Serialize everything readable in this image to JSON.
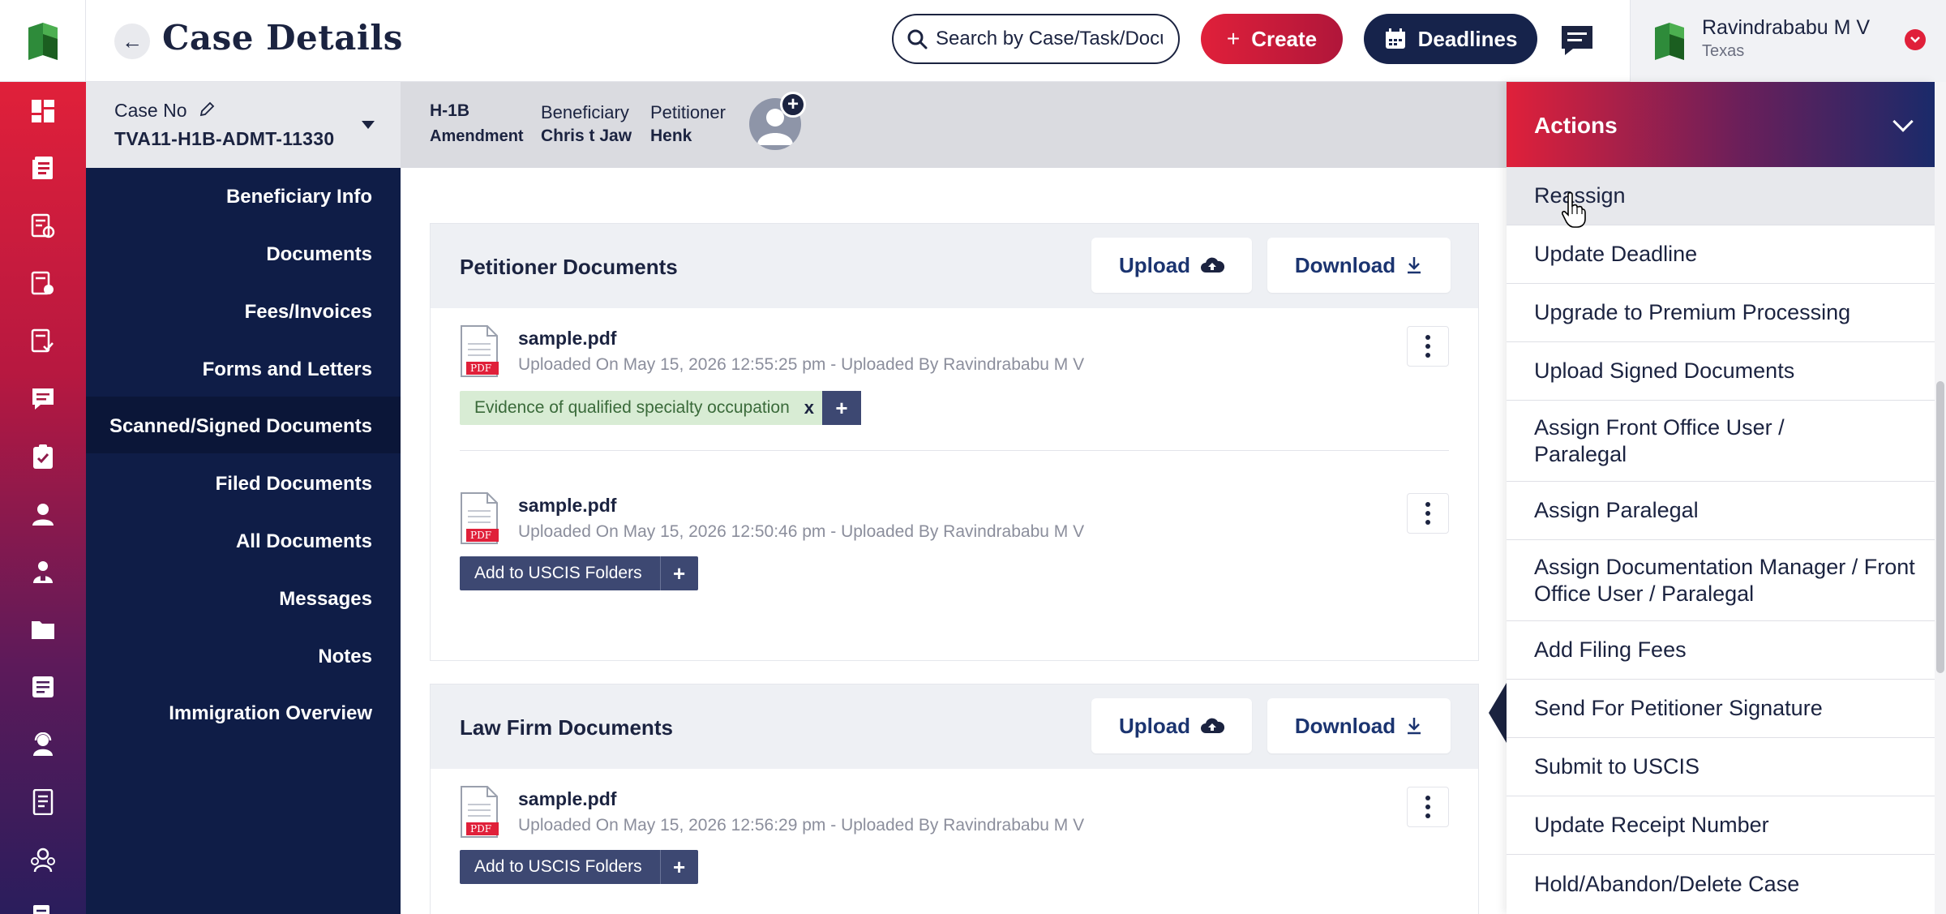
{
  "header": {
    "title": "Case Details",
    "search_placeholder": "Search by Case/Task/Document",
    "create_label": "Create",
    "deadlines_label": "Deadlines",
    "user": {
      "name": "Ravindrababu M V",
      "location": "Texas"
    }
  },
  "case": {
    "case_no_label": "Case No",
    "case_no": "TVA11-H1B-ADMT-11330",
    "visa_type": "H-1B",
    "case_kind": "Amendment",
    "beneficiary_label": "Beneficiary",
    "beneficiary": "Chris t Jaw",
    "petitioner_label": "Petitioner",
    "petitioner": "Henk"
  },
  "subnav": {
    "items": [
      {
        "label": "Beneficiary Info"
      },
      {
        "label": "Documents"
      },
      {
        "label": "Fees/Invoices"
      },
      {
        "label": "Forms and Letters"
      },
      {
        "label": "Scanned/Signed Documents"
      },
      {
        "label": "Filed Documents"
      },
      {
        "label": "All Documents"
      },
      {
        "label": "Messages"
      },
      {
        "label": "Notes"
      },
      {
        "label": "Immigration Overview"
      }
    ],
    "active": "Scanned/Signed Documents"
  },
  "sections": [
    {
      "title": "Petitioner Documents",
      "upload_label": "Upload",
      "download_label": "Download",
      "docs": [
        {
          "name": "sample.pdf",
          "meta": "Uploaded On May 15, 2026 12:55:25 pm - Uploaded By Ravindrababu M V",
          "tag": "Evidence of qualified specialty occupation",
          "tag_close": "x"
        },
        {
          "name": "sample.pdf",
          "meta": "Uploaded On May 15, 2026 12:50:46 pm - Uploaded By Ravindrababu M V",
          "tag": "Add to USCIS Folders"
        }
      ]
    },
    {
      "title": "Law Firm Documents",
      "upload_label": "Upload",
      "download_label": "Download",
      "docs": [
        {
          "name": "sample.pdf",
          "meta": "Uploaded On May 15, 2026 12:56:29 pm - Uploaded By Ravindrababu M V",
          "tag": "Add to USCIS Folders"
        }
      ]
    }
  ],
  "pdf_badge": "PDF",
  "actions": {
    "title": "Actions",
    "items": [
      {
        "label": "Reassign"
      },
      {
        "label": "Update Deadline"
      },
      {
        "label": "Upgrade to Premium Processing"
      },
      {
        "label": "Upload Signed Documents"
      },
      {
        "label": "Assign Front Office User / Paralegal"
      },
      {
        "label": "Assign Paralegal"
      },
      {
        "label": "Assign Documentation Manager / Front Office User / Paralegal"
      },
      {
        "label": "Add Filing Fees"
      },
      {
        "label": "Send For Petitioner Signature"
      },
      {
        "label": "Submit to USCIS"
      },
      {
        "label": "Update Receipt Number"
      },
      {
        "label": "Hold/Abandon/Delete Case"
      }
    ]
  },
  "colors": {
    "brand_red": "#e0203a",
    "navy": "#0f1d47",
    "tag_green": "#d8ecd4"
  }
}
